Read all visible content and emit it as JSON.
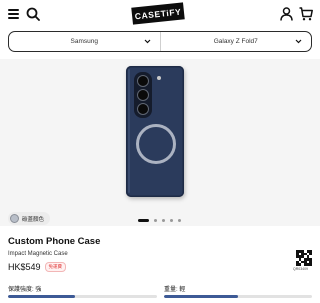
{
  "header": {
    "logo_text": "CASETiFY",
    "icons": [
      "menu-icon",
      "search-icon",
      "user-icon",
      "cart-icon"
    ]
  },
  "device_selector": {
    "brand": "Samsung",
    "model": "Galaxy Z Fold7"
  },
  "gallery": {
    "slide_count": 5,
    "active_slide": 1
  },
  "color_option": {
    "label": "碳蓋顏色"
  },
  "product": {
    "title": "Custom Phone Case",
    "subtitle": "Impact Magnetic Case",
    "price": "HK$549",
    "badge": "免運費",
    "qr_code_text": "QR03409"
  },
  "ratings": [
    {
      "label": "保護強度: 強",
      "fraction": 0.45
    },
    {
      "label": "重量: 輕",
      "fraction": 0.5
    }
  ],
  "colors": {
    "case_blue": "#2b3b5c",
    "accent_bar": "#3d5a96",
    "badge_red": "#e03b3b"
  }
}
